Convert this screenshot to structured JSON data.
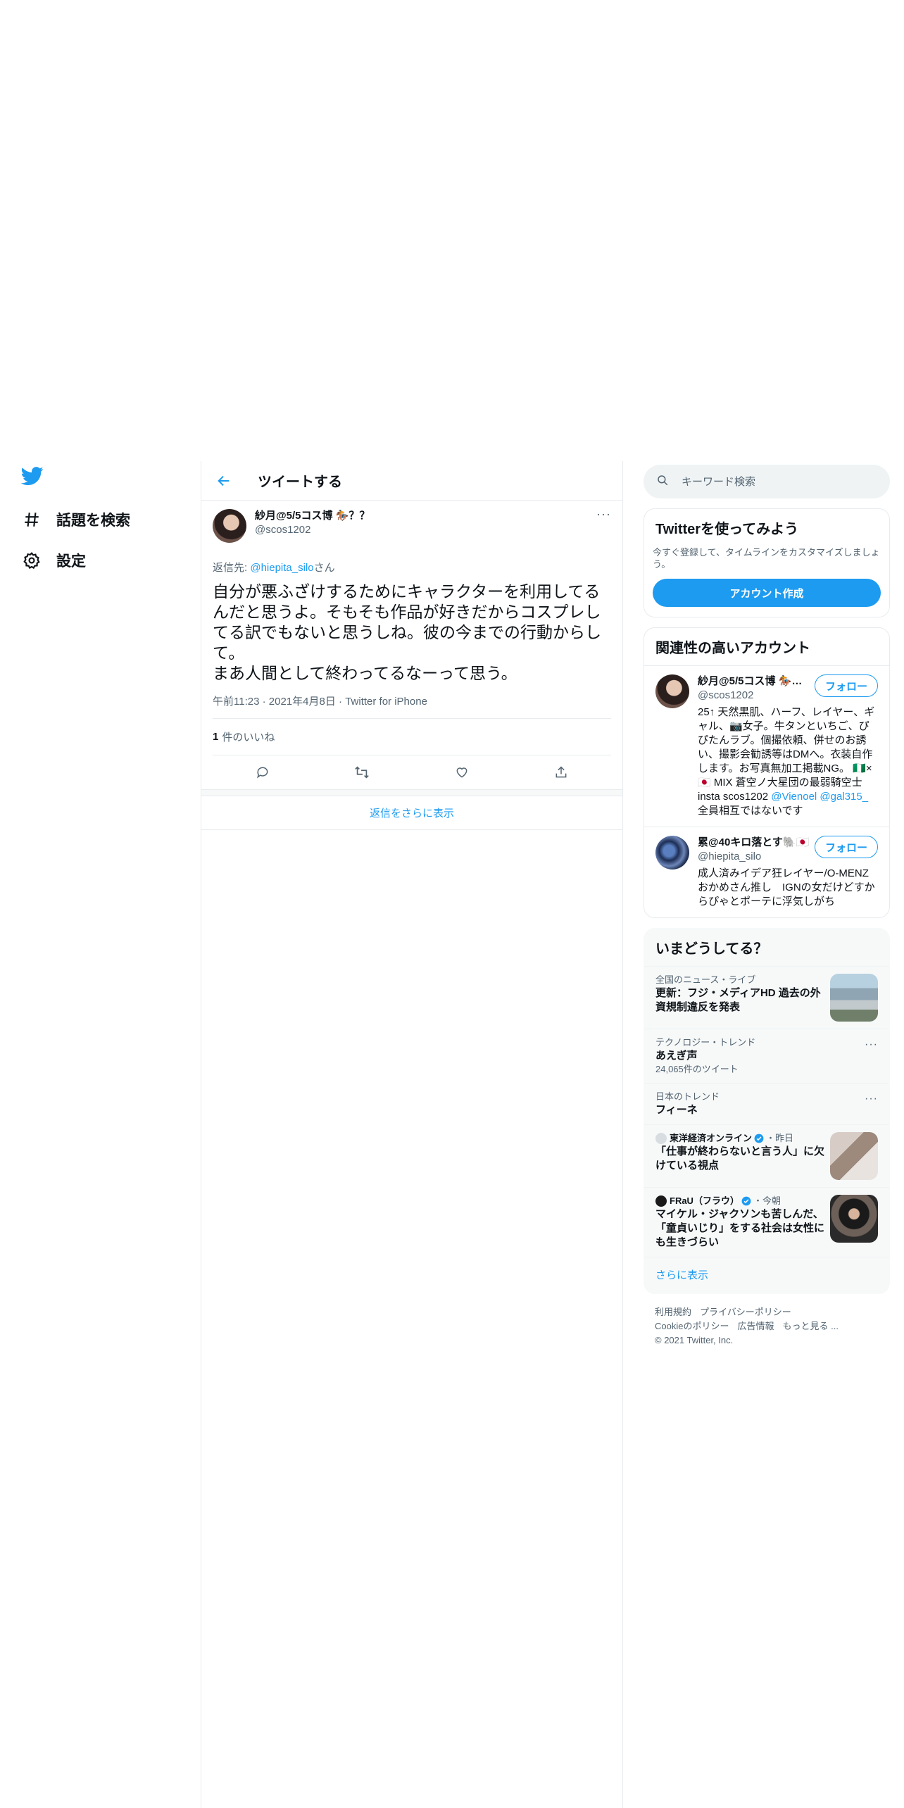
{
  "nav": {
    "explore_label": "話題を検索",
    "settings_label": "設定"
  },
  "header": {
    "title": "ツイートする"
  },
  "tweet": {
    "author_name": "紗月@5/5コス博 🏇？？",
    "author_handle": "@scos1202",
    "reply_prefix": "返信先: ",
    "reply_mention": "@hiepita_silo",
    "reply_suffix": "さん",
    "text": "自分が悪ふざけするためにキャラクターを利用してるんだと思うよ。そもそも作品が好きだからコスプレしてる訳でもないと思うしね。彼の今までの行動からして。\nまあ人間として終わってるなーって思う。",
    "time": "午前11:23",
    "date": "2021年4月8日",
    "source": "Twitter for iPhone",
    "like_count": "1",
    "like_label": "件のいいね",
    "more_glyph": "···"
  },
  "show_more_replies": "返信をさらに表示",
  "search": {
    "placeholder": "キーワード検索"
  },
  "signup": {
    "title": "Twitterを使ってみよう",
    "desc": "今すぐ登録して、タイムラインをカスタマイズしましょう。",
    "button": "アカウント作成"
  },
  "related": {
    "title": "関連性の高いアカウント",
    "follow_label": "フォロー",
    "accounts": [
      {
        "name": "紗月@5/5コス博 🏇…",
        "handle": "@scos1202",
        "bio": "25↑ 天然黒肌、ハーフ、レイヤー、ギャル、📷女子。牛タンといちご、ぴぴたんラブ。個撮依頼、併せのお誘い、撮影会勧誘等はDMへ。衣装自作します。お写真無加工掲載NG。 🇳🇬×🇯🇵 MIX 蒼空ノ大星団の最弱騎空士 insta scos1202",
        "mention1": "@Vienoel",
        "mention2": "@gal315_",
        "bio_tail": "全員相互ではないです"
      },
      {
        "name": "累@40キロ落とす🐘🇯🇵",
        "handle": "@hiepita_silo",
        "bio": "成人済みイデア狂レイヤー/O-MENZおかめさん推し　IGNの女だけどすからぴゃとポーテに浮気しがち"
      }
    ]
  },
  "trends": {
    "title": "いまどうしてる？",
    "items": [
      {
        "ctx": "全国のニュース・ライブ",
        "title": "更新：フジ・メディアHD 過去の外資規制違反を発表"
      },
      {
        "ctx": "テクノロジー・トレンド",
        "title": "あえぎ声",
        "sub": "24,065件のツイート"
      },
      {
        "ctx": "日本のトレンド",
        "title": "フィーネ"
      },
      {
        "source": "東洋経済オンライン",
        "time": "・昨日",
        "title": "「仕事が終わらないと言う人」に欠けている視点"
      },
      {
        "source": "FRaU（フラウ）",
        "time": "・今朝",
        "title": "マイケル・ジャクソンも苦しんだ、「童貞いじり」をする社会は女性にも生きづらい"
      }
    ],
    "show_more": "さらに表示"
  },
  "footer": {
    "terms": "利用規約",
    "privacy": "プライバシーポリシー",
    "cookies": "Cookieのポリシー",
    "ads": "広告情報",
    "more": "もっと見る ...",
    "copyright": "© 2021 Twitter, Inc."
  },
  "colors": {
    "accent": "#1d9bf0",
    "text": "#0f1419",
    "muted": "#536471",
    "border": "#e8ecef"
  }
}
